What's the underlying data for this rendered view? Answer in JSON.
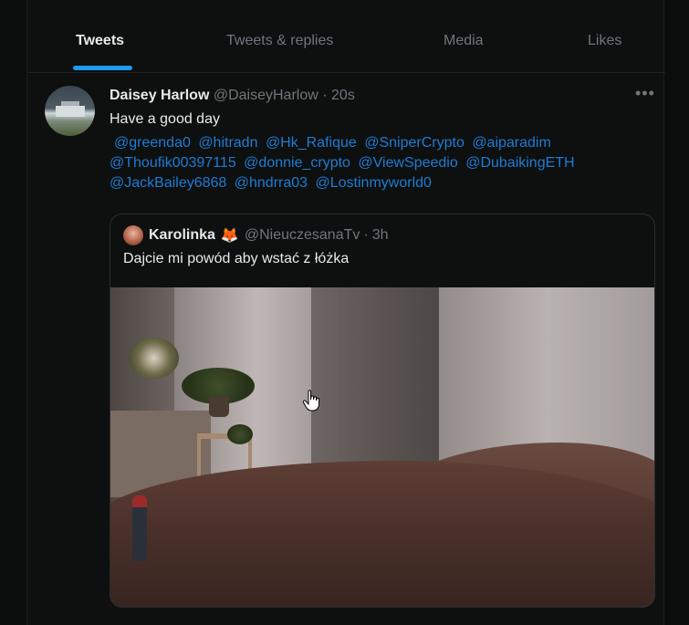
{
  "tabs": [
    {
      "label": "Tweets"
    },
    {
      "label": "Tweets & replies"
    },
    {
      "label": "Media"
    },
    {
      "label": "Likes"
    }
  ],
  "active_tab": "Tweets",
  "tweet": {
    "display_name": "Daisey Harlow",
    "handle": "@DaiseyHarlow",
    "separator": "·",
    "time": "20s",
    "more_icon": "more-horizontal-icon",
    "text": "Have a good day",
    "mentions": [
      "@greenda0",
      "@hitradn",
      "@Hk_Rafique",
      "@SniperCrypto",
      "@aiparadim",
      "@Thoufik00397115",
      "@donnie_crypto",
      "@ViewSpeedio",
      "@DubaikingETH",
      "@JackBailey6868",
      "@hndrra03",
      "@Lostinmyworld0"
    ]
  },
  "quoted_tweet": {
    "display_name": "Karolinka",
    "name_emoji": "🦊",
    "handle": "@NieuczesanaTv",
    "separator": "·",
    "time": "3h",
    "text": "Dajcie mi powód aby wstać z łóżka",
    "media_icon": "photo-bedroom"
  },
  "colors": {
    "accent": "#1d9bf0",
    "mention": "#1d7dd6",
    "background": "#0e0f0f",
    "muted_text": "#71767b"
  }
}
